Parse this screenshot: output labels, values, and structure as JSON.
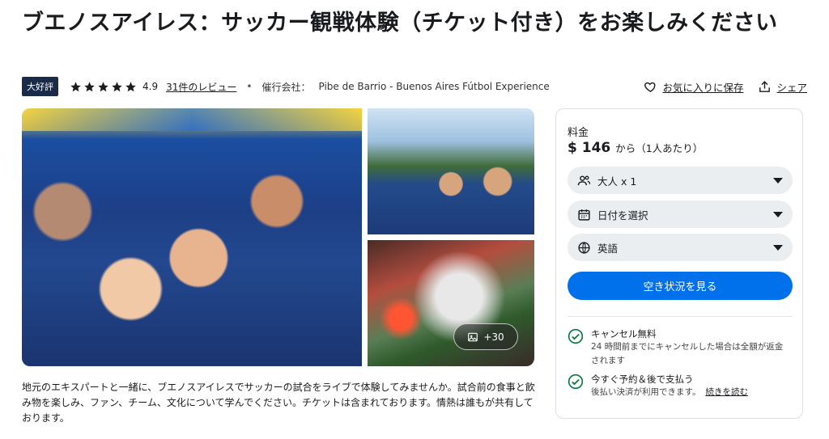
{
  "title": "ブエノスアイレス：サッカー観戦体験（チケット付き）をお楽しみください",
  "meta": {
    "badge": "大好評",
    "rating": "4.9",
    "reviews_link": "31件のレビュー",
    "separator": "•",
    "organizer_label": "催行会社：",
    "organizer": "Pibe de Barrio - Buenos Aires Fútbol Experience",
    "wishlist": "お気に入りに保存",
    "share": "シェア"
  },
  "gallery": {
    "more_photos": "+30"
  },
  "description": "地元のエキスパートと一緒に、ブエノスアイレスでサッカーの試合をライブで体験してみませんか。試合前の食事と飲み物を楽しみ、ファン、チーム、文化について学んでください。チケットは含まれております。情熱は誰もが共有しております。",
  "booking": {
    "price_label": "料金",
    "price": "$ 146",
    "price_suffix": "から（1人あたり）",
    "participants": "大人 x 1",
    "date": "日付を選択",
    "language": "英語",
    "cta": "空き状況を見る",
    "features": [
      {
        "title": "キャンセル無料",
        "subtitle": "24 時間前までにキャンセルした場合は全額が返金されます"
      },
      {
        "title": "今すぐ予約＆後で支払う",
        "subtitle": "後払い決済が利用できます。",
        "link": "続きを読む"
      }
    ]
  },
  "colors": {
    "accent": "#0071eb",
    "badge": "#1a2b49",
    "check": "#0d7a45",
    "chip": "#ebeef1"
  },
  "icons": [
    "star-icon",
    "heart-icon",
    "share-icon",
    "image-icon",
    "users-icon",
    "calendar-icon",
    "globe-icon",
    "check-circle-icon",
    "caret-down-icon"
  ]
}
